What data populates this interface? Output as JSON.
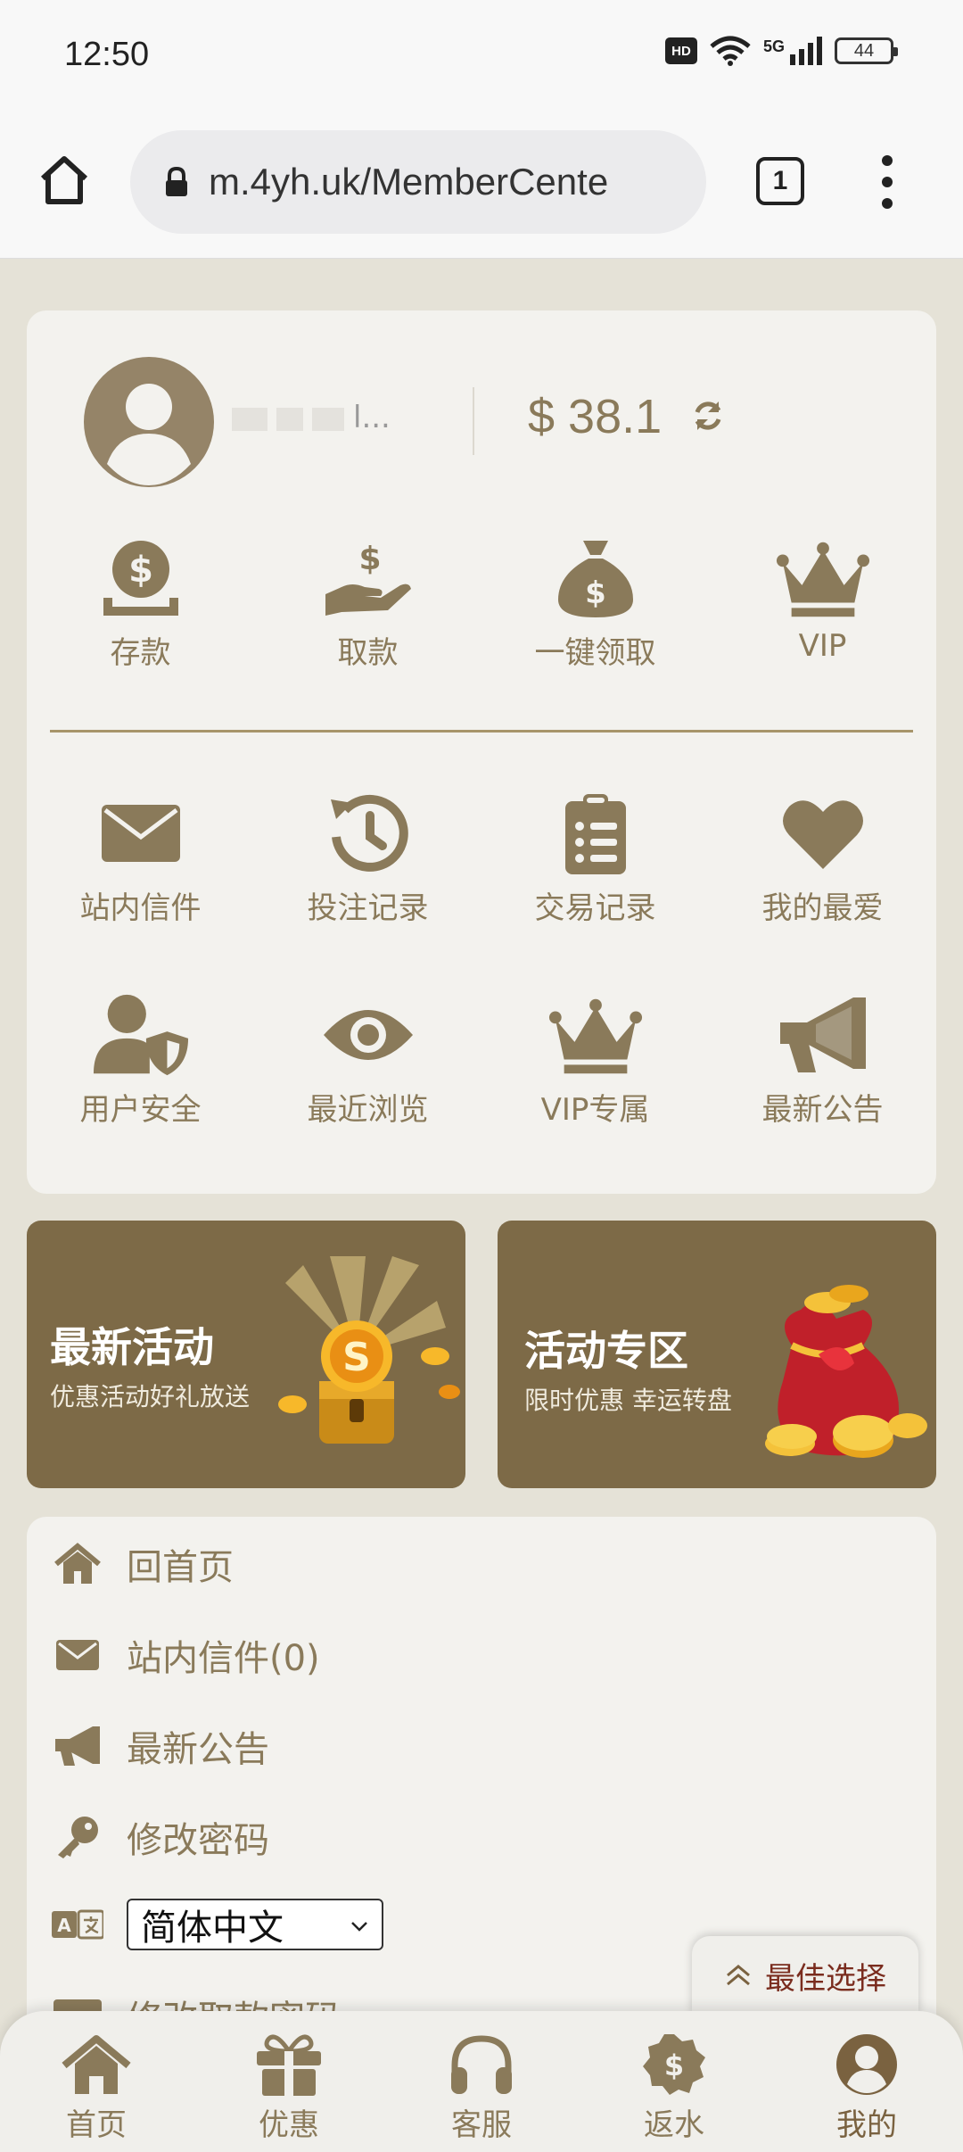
{
  "status_bar": {
    "time": "12:50",
    "hd": "HD",
    "network": "5G",
    "battery": "44"
  },
  "browser": {
    "url": "m.4yh.uk/MemberCente",
    "tab_count": "1"
  },
  "member": {
    "username": "l...",
    "balance": "$ 38.1",
    "quick_actions": [
      {
        "label": "存款",
        "icon": "deposit-coin-icon"
      },
      {
        "label": "取款",
        "icon": "withdraw-hand-icon"
      },
      {
        "label": "一键领取",
        "icon": "money-bag-icon"
      },
      {
        "label": "VIP",
        "icon": "crown-icon"
      }
    ],
    "features_row1": [
      {
        "label": "站内信件",
        "icon": "envelope-icon"
      },
      {
        "label": "投注记录",
        "icon": "history-icon"
      },
      {
        "label": "交易记录",
        "icon": "clipboard-list-icon"
      },
      {
        "label": "我的最爱",
        "icon": "heart-icon"
      }
    ],
    "features_row2": [
      {
        "label": "用户安全",
        "icon": "user-shield-icon"
      },
      {
        "label": "最近浏览",
        "icon": "eye-icon"
      },
      {
        "label": "VIP专属",
        "icon": "crown-icon"
      },
      {
        "label": "最新公告",
        "icon": "megaphone-icon"
      }
    ]
  },
  "promos": [
    {
      "title": "最新活动",
      "subtitle": "优惠活动好礼放送"
    },
    {
      "title": "活动专区",
      "subtitle": "限时优惠 幸运转盘"
    }
  ],
  "menu": {
    "items": [
      {
        "label": "回首页",
        "icon": "home-icon"
      },
      {
        "label": "站内信件(0)",
        "icon": "envelope-icon"
      },
      {
        "label": "最新公告",
        "icon": "megaphone-icon"
      },
      {
        "label": "修改密码",
        "icon": "key-icon"
      }
    ],
    "language_icon": "translate-icon",
    "language_selected": "简体中文",
    "partial_item": "修改取款密码"
  },
  "best_choice": "最佳选择",
  "bottom_nav": [
    {
      "label": "首页",
      "icon": "home-icon"
    },
    {
      "label": "优惠",
      "icon": "gift-icon"
    },
    {
      "label": "客服",
      "icon": "headset-icon"
    },
    {
      "label": "返水",
      "icon": "rebate-coin-icon"
    },
    {
      "label": "我的",
      "icon": "user-circle-icon"
    }
  ],
  "colors": {
    "accent": "#8a7a5a",
    "banner": "#7d6a47",
    "background": "#e5e2d7",
    "card": "#f3f2ee",
    "best_text": "#7a2c1e"
  }
}
